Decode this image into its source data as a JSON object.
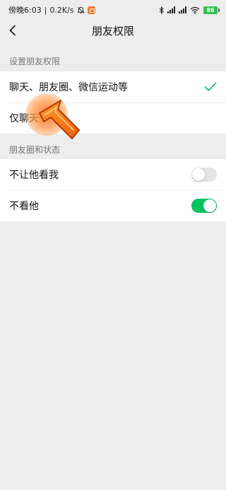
{
  "status_bar": {
    "time": "傍晚6:03",
    "network_speed": "0.2K/s",
    "separator": "|",
    "battery_level": "86",
    "battery_color": "#35c24f"
  },
  "header": {
    "title": "朋友权限",
    "back_icon": "chevron-left-icon"
  },
  "permission_section": {
    "title": "设置朋友权限",
    "options": [
      {
        "label": "聊天、朋友圈、微信运动等",
        "selected": true
      },
      {
        "label": "仅聊天",
        "selected": false
      }
    ],
    "check_color": "#07c160"
  },
  "moments_section": {
    "title": "朋友圈和状态",
    "toggles": [
      {
        "label": "不让他看我",
        "on": false
      },
      {
        "label": "不看他",
        "on": true
      }
    ],
    "toggle_on_color": "#07c160"
  },
  "overlay": {
    "tap_marker": "orange-tap-highlight",
    "arrow": "orange-pointer-arrow-icon"
  }
}
